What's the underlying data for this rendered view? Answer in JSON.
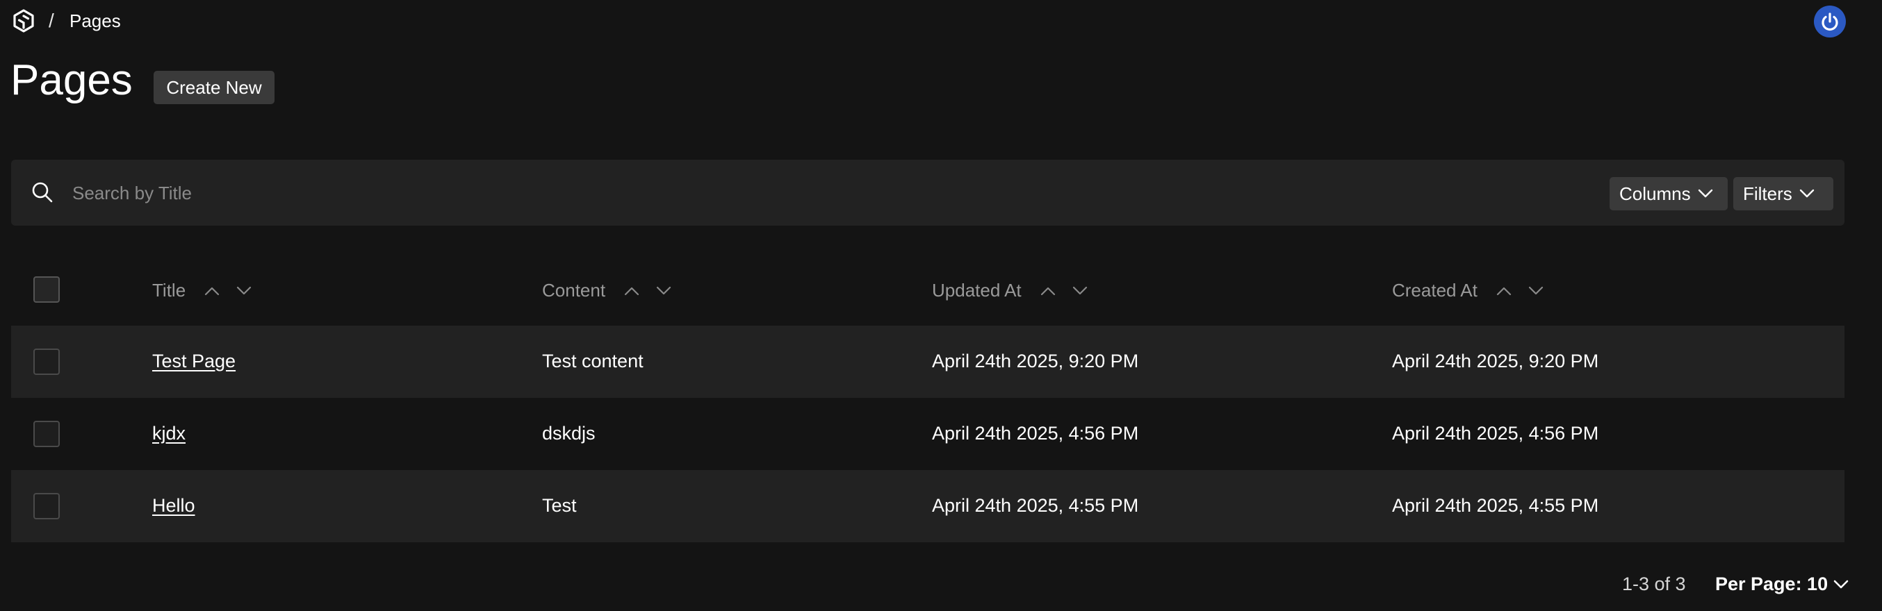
{
  "breadcrumb": {
    "separator": "/",
    "current": "Pages"
  },
  "page": {
    "title": "Pages",
    "create_label": "Create New"
  },
  "search": {
    "placeholder": "Search by Title"
  },
  "toolbar": {
    "columns_label": "Columns",
    "filters_label": "Filters"
  },
  "table": {
    "headers": {
      "title": "Title",
      "content": "Content",
      "updated_at": "Updated At",
      "created_at": "Created At"
    },
    "rows": [
      {
        "title": "Test Page",
        "content": "Test content",
        "updated_at": "April 24th 2025, 9:20 PM",
        "created_at": "April 24th 2025, 9:20 PM"
      },
      {
        "title": "kjdx",
        "content": "dskdjs",
        "updated_at": "April 24th 2025, 4:56 PM",
        "created_at": "April 24th 2025, 4:56 PM"
      },
      {
        "title": "Hello",
        "content": "Test",
        "updated_at": "April 24th 2025, 4:55 PM",
        "created_at": "April 24th 2025, 4:55 PM"
      }
    ]
  },
  "pagination": {
    "range": "1-3 of 3",
    "per_page": "Per Page: 10"
  },
  "icons": {
    "logo": "logo-icon",
    "power": "power-icon",
    "search": "search-icon",
    "chevron": "chevron-down-icon",
    "sort_asc": "sort-asc-icon",
    "sort_desc": "sort-desc-icon"
  },
  "colors": {
    "background": "#141414",
    "panel": "#222222",
    "button": "#3a3a3a",
    "accent": "#2b59c3"
  }
}
